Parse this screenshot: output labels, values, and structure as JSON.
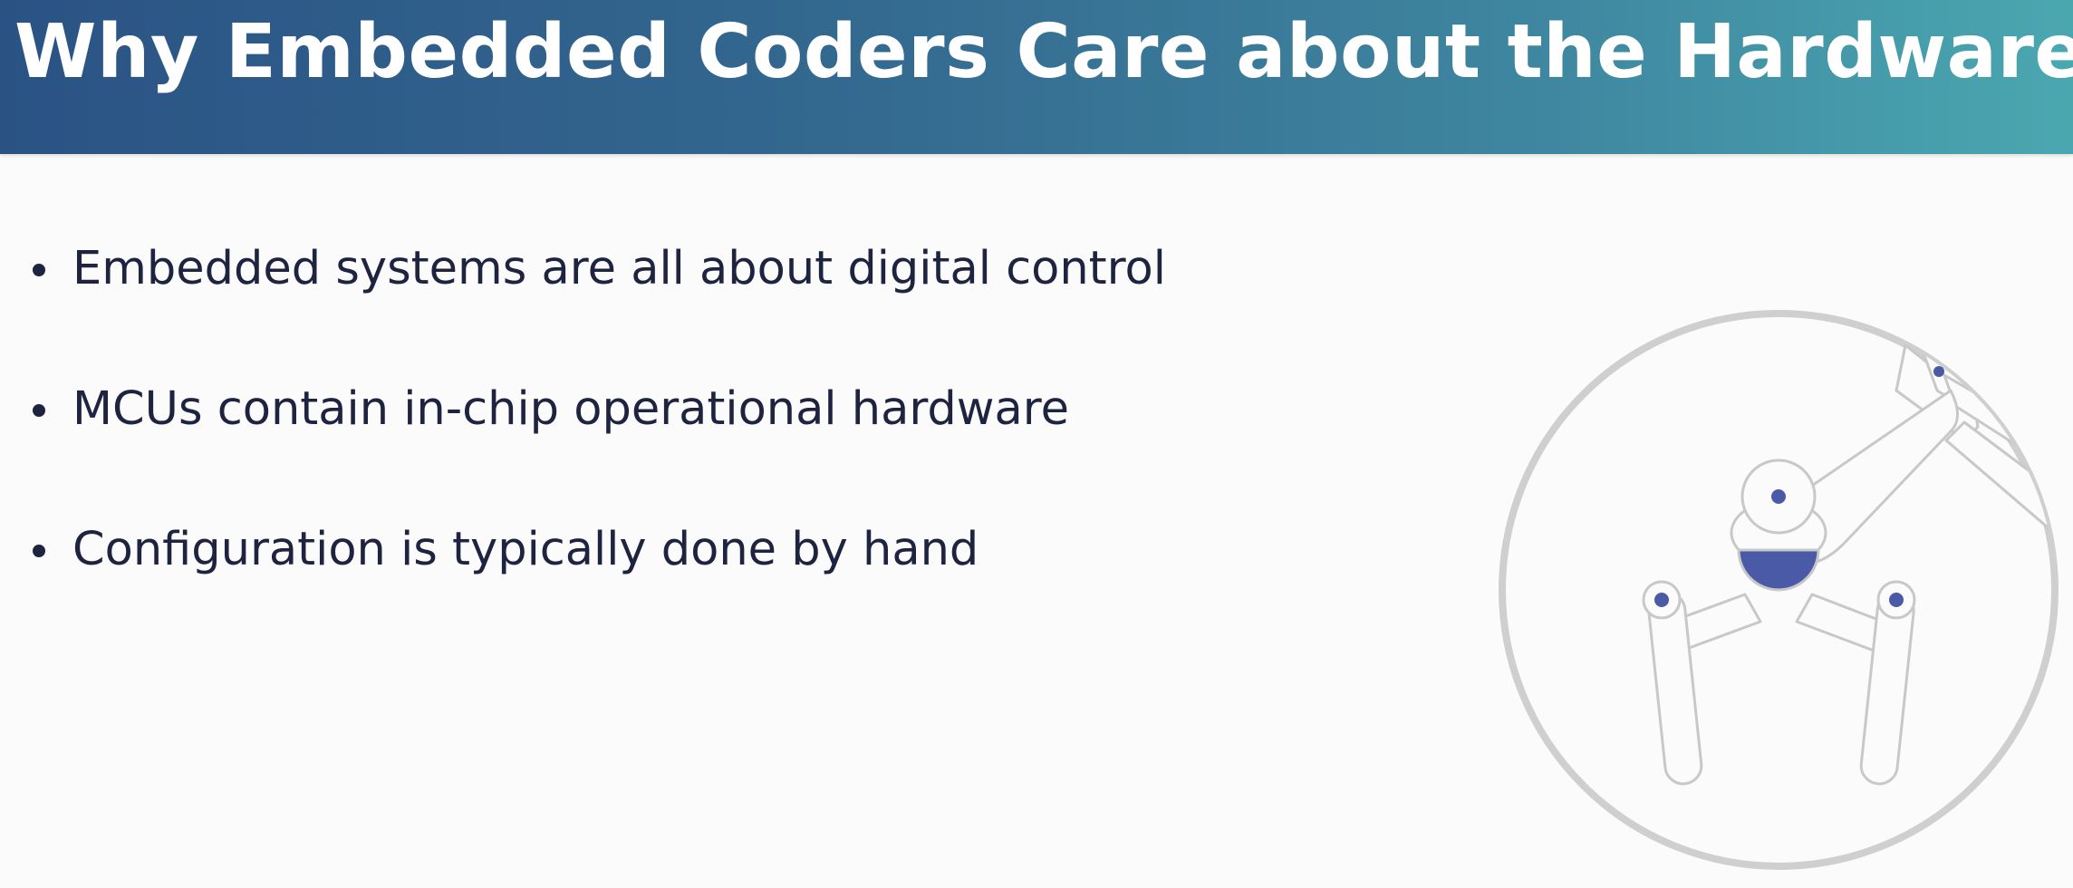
{
  "slide": {
    "title": "Why Embedded Coders Care about the Hardware",
    "bullets": [
      "Embedded systems are all about digital control",
      "MCUs contain in-chip operational hardware",
      "Configuration is typically done by hand"
    ],
    "illustration_icon": "robotic-arm-gripper-icon"
  },
  "colors": {
    "header_gradient_start": "#2a5384",
    "header_gradient_end": "#4aa7b0",
    "title_text": "#ffffff",
    "body_text": "#1e2340",
    "accent_joint": "#4b5aa6",
    "circle_outline": "#cfcfcf"
  }
}
